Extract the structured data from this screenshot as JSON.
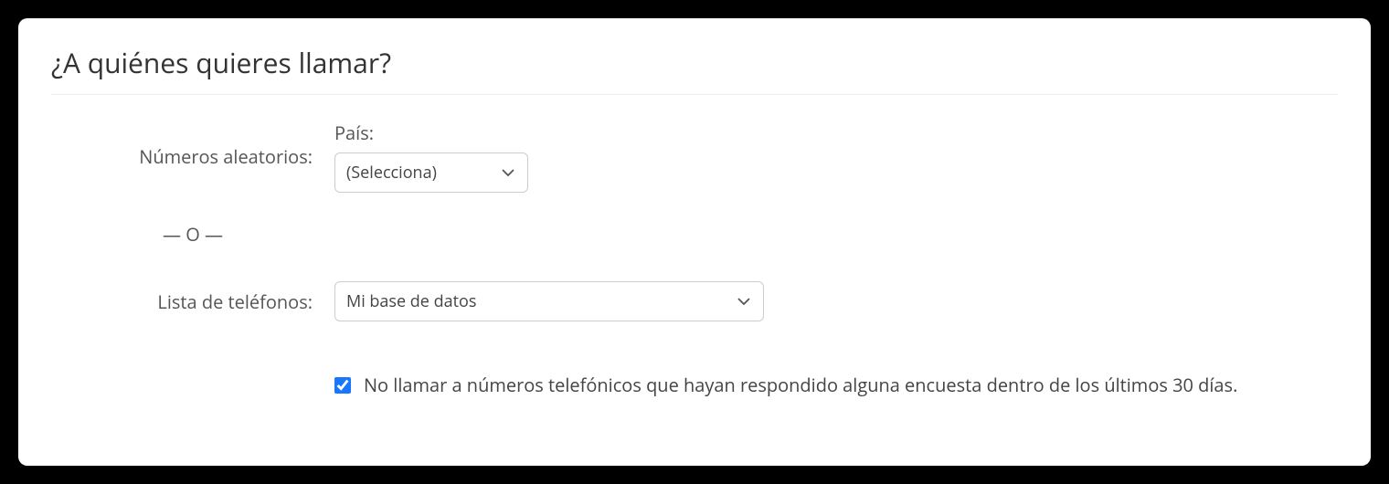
{
  "title": "¿A quiénes quieres llamar?",
  "random": {
    "label": "Números aleatorios:",
    "country_label": "País:",
    "select_placeholder": "(Selecciona)"
  },
  "separator": "— O —",
  "phonelist": {
    "label": "Lista de teléfonos:",
    "selected": "Mi base de datos"
  },
  "checkbox": {
    "label": "No llamar a números telefónicos que hayan respondido alguna encuesta dentro de los últimos 30 días.",
    "checked": true
  }
}
